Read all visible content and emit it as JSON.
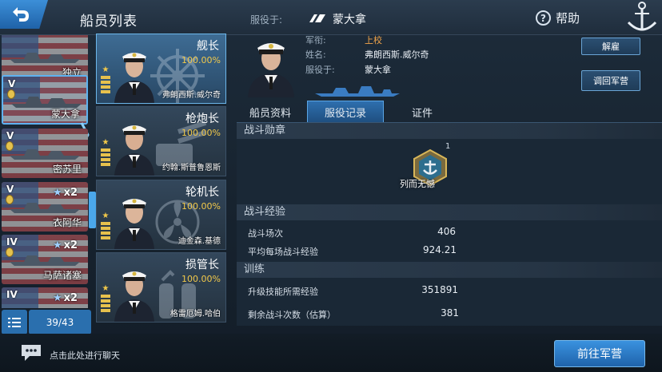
{
  "header": {
    "title": "船员列表",
    "serve_label": "服役于:",
    "serve_ship": "蒙大拿",
    "help_label": "帮助"
  },
  "ship_list": {
    "items": [
      {
        "name": "独立",
        "tier": "",
        "multiplier": "",
        "selected": false
      },
      {
        "name": "蒙大拿",
        "tier": "V",
        "multiplier": "",
        "selected": true
      },
      {
        "name": "密苏里",
        "tier": "V",
        "multiplier": "",
        "selected": false
      },
      {
        "name": "衣阿华",
        "tier": "V",
        "multiplier": "x2",
        "selected": false
      },
      {
        "name": "马萨诸塞",
        "tier": "IV",
        "multiplier": "x2",
        "selected": false
      },
      {
        "name": "",
        "tier": "IV",
        "multiplier": "x2",
        "selected": false
      }
    ],
    "count": "39/43"
  },
  "crew": [
    {
      "role": "舰长",
      "percent": "100.00%",
      "name": "弗朗西斯.威尔奇",
      "selected": true,
      "emblem": "ship-wheel"
    },
    {
      "role": "枪炮长",
      "percent": "100.00%",
      "name": "约翰.斯普鲁恩斯",
      "selected": false,
      "emblem": "turret"
    },
    {
      "role": "轮机长",
      "percent": "100.00%",
      "name": "迪金森.基德",
      "selected": false,
      "emblem": "propeller"
    },
    {
      "role": "损管长",
      "percent": "100.00%",
      "name": "格雷厄姆.哈伯",
      "selected": false,
      "emblem": "extinguisher"
    }
  ],
  "officer": {
    "rank_label": "军衔:",
    "rank_value": "上校",
    "name_label": "姓名:",
    "name_value": "弗朗西斯.威尔奇",
    "serve_label": "服役于:",
    "serve_value": "蒙大拿"
  },
  "buttons": {
    "dismiss": "解雇",
    "recall": "调回军营",
    "go_barracks": "前往军营"
  },
  "tabs": [
    {
      "label": "船员资料",
      "active": false
    },
    {
      "label": "服役记录",
      "active": true
    },
    {
      "label": "证件",
      "active": false
    }
  ],
  "record": {
    "medals_title": "战斗勋章",
    "medal": {
      "name": "列而无憾",
      "count": "1"
    },
    "experience_title": "战斗经验",
    "battles_label": "战斗场次",
    "battles_value": "406",
    "avg_exp_label": "平均每场战斗经验",
    "avg_exp_value": "924.21",
    "training_title": "训练",
    "upgrade_label": "升级技能所需经验",
    "upgrade_value": "351891",
    "remaining_label": "剩余战斗次数（估算）",
    "remaining_value": "381"
  },
  "footer": {
    "chat_hint": "点击此处进行聊天"
  },
  "colors": {
    "accent_blue": "#2f80c8",
    "rank_orange": "#f2a44a",
    "percent_yellow": "#f2c94a"
  }
}
